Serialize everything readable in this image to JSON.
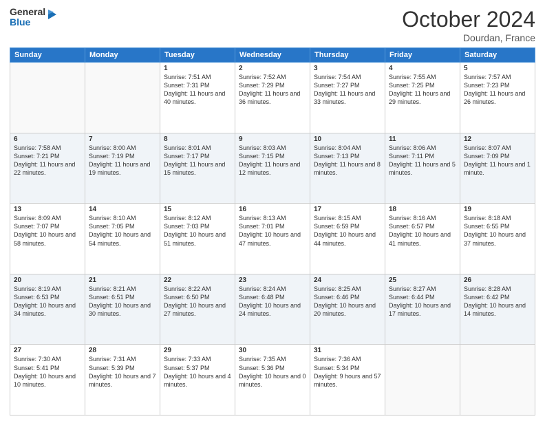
{
  "header": {
    "logo_general": "General",
    "logo_blue": "Blue",
    "month_title": "October 2024",
    "location": "Dourdan, France"
  },
  "days_of_week": [
    "Sunday",
    "Monday",
    "Tuesday",
    "Wednesday",
    "Thursday",
    "Friday",
    "Saturday"
  ],
  "weeks": [
    [
      {
        "day": "",
        "sunrise": "",
        "sunset": "",
        "daylight": ""
      },
      {
        "day": "",
        "sunrise": "",
        "sunset": "",
        "daylight": ""
      },
      {
        "day": "1",
        "sunrise": "Sunrise: 7:51 AM",
        "sunset": "Sunset: 7:31 PM",
        "daylight": "Daylight: 11 hours and 40 minutes."
      },
      {
        "day": "2",
        "sunrise": "Sunrise: 7:52 AM",
        "sunset": "Sunset: 7:29 PM",
        "daylight": "Daylight: 11 hours and 36 minutes."
      },
      {
        "day": "3",
        "sunrise": "Sunrise: 7:54 AM",
        "sunset": "Sunset: 7:27 PM",
        "daylight": "Daylight: 11 hours and 33 minutes."
      },
      {
        "day": "4",
        "sunrise": "Sunrise: 7:55 AM",
        "sunset": "Sunset: 7:25 PM",
        "daylight": "Daylight: 11 hours and 29 minutes."
      },
      {
        "day": "5",
        "sunrise": "Sunrise: 7:57 AM",
        "sunset": "Sunset: 7:23 PM",
        "daylight": "Daylight: 11 hours and 26 minutes."
      }
    ],
    [
      {
        "day": "6",
        "sunrise": "Sunrise: 7:58 AM",
        "sunset": "Sunset: 7:21 PM",
        "daylight": "Daylight: 11 hours and 22 minutes."
      },
      {
        "day": "7",
        "sunrise": "Sunrise: 8:00 AM",
        "sunset": "Sunset: 7:19 PM",
        "daylight": "Daylight: 11 hours and 19 minutes."
      },
      {
        "day": "8",
        "sunrise": "Sunrise: 8:01 AM",
        "sunset": "Sunset: 7:17 PM",
        "daylight": "Daylight: 11 hours and 15 minutes."
      },
      {
        "day": "9",
        "sunrise": "Sunrise: 8:03 AM",
        "sunset": "Sunset: 7:15 PM",
        "daylight": "Daylight: 11 hours and 12 minutes."
      },
      {
        "day": "10",
        "sunrise": "Sunrise: 8:04 AM",
        "sunset": "Sunset: 7:13 PM",
        "daylight": "Daylight: 11 hours and 8 minutes."
      },
      {
        "day": "11",
        "sunrise": "Sunrise: 8:06 AM",
        "sunset": "Sunset: 7:11 PM",
        "daylight": "Daylight: 11 hours and 5 minutes."
      },
      {
        "day": "12",
        "sunrise": "Sunrise: 8:07 AM",
        "sunset": "Sunset: 7:09 PM",
        "daylight": "Daylight: 11 hours and 1 minute."
      }
    ],
    [
      {
        "day": "13",
        "sunrise": "Sunrise: 8:09 AM",
        "sunset": "Sunset: 7:07 PM",
        "daylight": "Daylight: 10 hours and 58 minutes."
      },
      {
        "day": "14",
        "sunrise": "Sunrise: 8:10 AM",
        "sunset": "Sunset: 7:05 PM",
        "daylight": "Daylight: 10 hours and 54 minutes."
      },
      {
        "day": "15",
        "sunrise": "Sunrise: 8:12 AM",
        "sunset": "Sunset: 7:03 PM",
        "daylight": "Daylight: 10 hours and 51 minutes."
      },
      {
        "day": "16",
        "sunrise": "Sunrise: 8:13 AM",
        "sunset": "Sunset: 7:01 PM",
        "daylight": "Daylight: 10 hours and 47 minutes."
      },
      {
        "day": "17",
        "sunrise": "Sunrise: 8:15 AM",
        "sunset": "Sunset: 6:59 PM",
        "daylight": "Daylight: 10 hours and 44 minutes."
      },
      {
        "day": "18",
        "sunrise": "Sunrise: 8:16 AM",
        "sunset": "Sunset: 6:57 PM",
        "daylight": "Daylight: 10 hours and 41 minutes."
      },
      {
        "day": "19",
        "sunrise": "Sunrise: 8:18 AM",
        "sunset": "Sunset: 6:55 PM",
        "daylight": "Daylight: 10 hours and 37 minutes."
      }
    ],
    [
      {
        "day": "20",
        "sunrise": "Sunrise: 8:19 AM",
        "sunset": "Sunset: 6:53 PM",
        "daylight": "Daylight: 10 hours and 34 minutes."
      },
      {
        "day": "21",
        "sunrise": "Sunrise: 8:21 AM",
        "sunset": "Sunset: 6:51 PM",
        "daylight": "Daylight: 10 hours and 30 minutes."
      },
      {
        "day": "22",
        "sunrise": "Sunrise: 8:22 AM",
        "sunset": "Sunset: 6:50 PM",
        "daylight": "Daylight: 10 hours and 27 minutes."
      },
      {
        "day": "23",
        "sunrise": "Sunrise: 8:24 AM",
        "sunset": "Sunset: 6:48 PM",
        "daylight": "Daylight: 10 hours and 24 minutes."
      },
      {
        "day": "24",
        "sunrise": "Sunrise: 8:25 AM",
        "sunset": "Sunset: 6:46 PM",
        "daylight": "Daylight: 10 hours and 20 minutes."
      },
      {
        "day": "25",
        "sunrise": "Sunrise: 8:27 AM",
        "sunset": "Sunset: 6:44 PM",
        "daylight": "Daylight: 10 hours and 17 minutes."
      },
      {
        "day": "26",
        "sunrise": "Sunrise: 8:28 AM",
        "sunset": "Sunset: 6:42 PM",
        "daylight": "Daylight: 10 hours and 14 minutes."
      }
    ],
    [
      {
        "day": "27",
        "sunrise": "Sunrise: 7:30 AM",
        "sunset": "Sunset: 5:41 PM",
        "daylight": "Daylight: 10 hours and 10 minutes."
      },
      {
        "day": "28",
        "sunrise": "Sunrise: 7:31 AM",
        "sunset": "Sunset: 5:39 PM",
        "daylight": "Daylight: 10 hours and 7 minutes."
      },
      {
        "day": "29",
        "sunrise": "Sunrise: 7:33 AM",
        "sunset": "Sunset: 5:37 PM",
        "daylight": "Daylight: 10 hours and 4 minutes."
      },
      {
        "day": "30",
        "sunrise": "Sunrise: 7:35 AM",
        "sunset": "Sunset: 5:36 PM",
        "daylight": "Daylight: 10 hours and 0 minutes."
      },
      {
        "day": "31",
        "sunrise": "Sunrise: 7:36 AM",
        "sunset": "Sunset: 5:34 PM",
        "daylight": "Daylight: 9 hours and 57 minutes."
      },
      {
        "day": "",
        "sunrise": "",
        "sunset": "",
        "daylight": ""
      },
      {
        "day": "",
        "sunrise": "",
        "sunset": "",
        "daylight": ""
      }
    ]
  ]
}
